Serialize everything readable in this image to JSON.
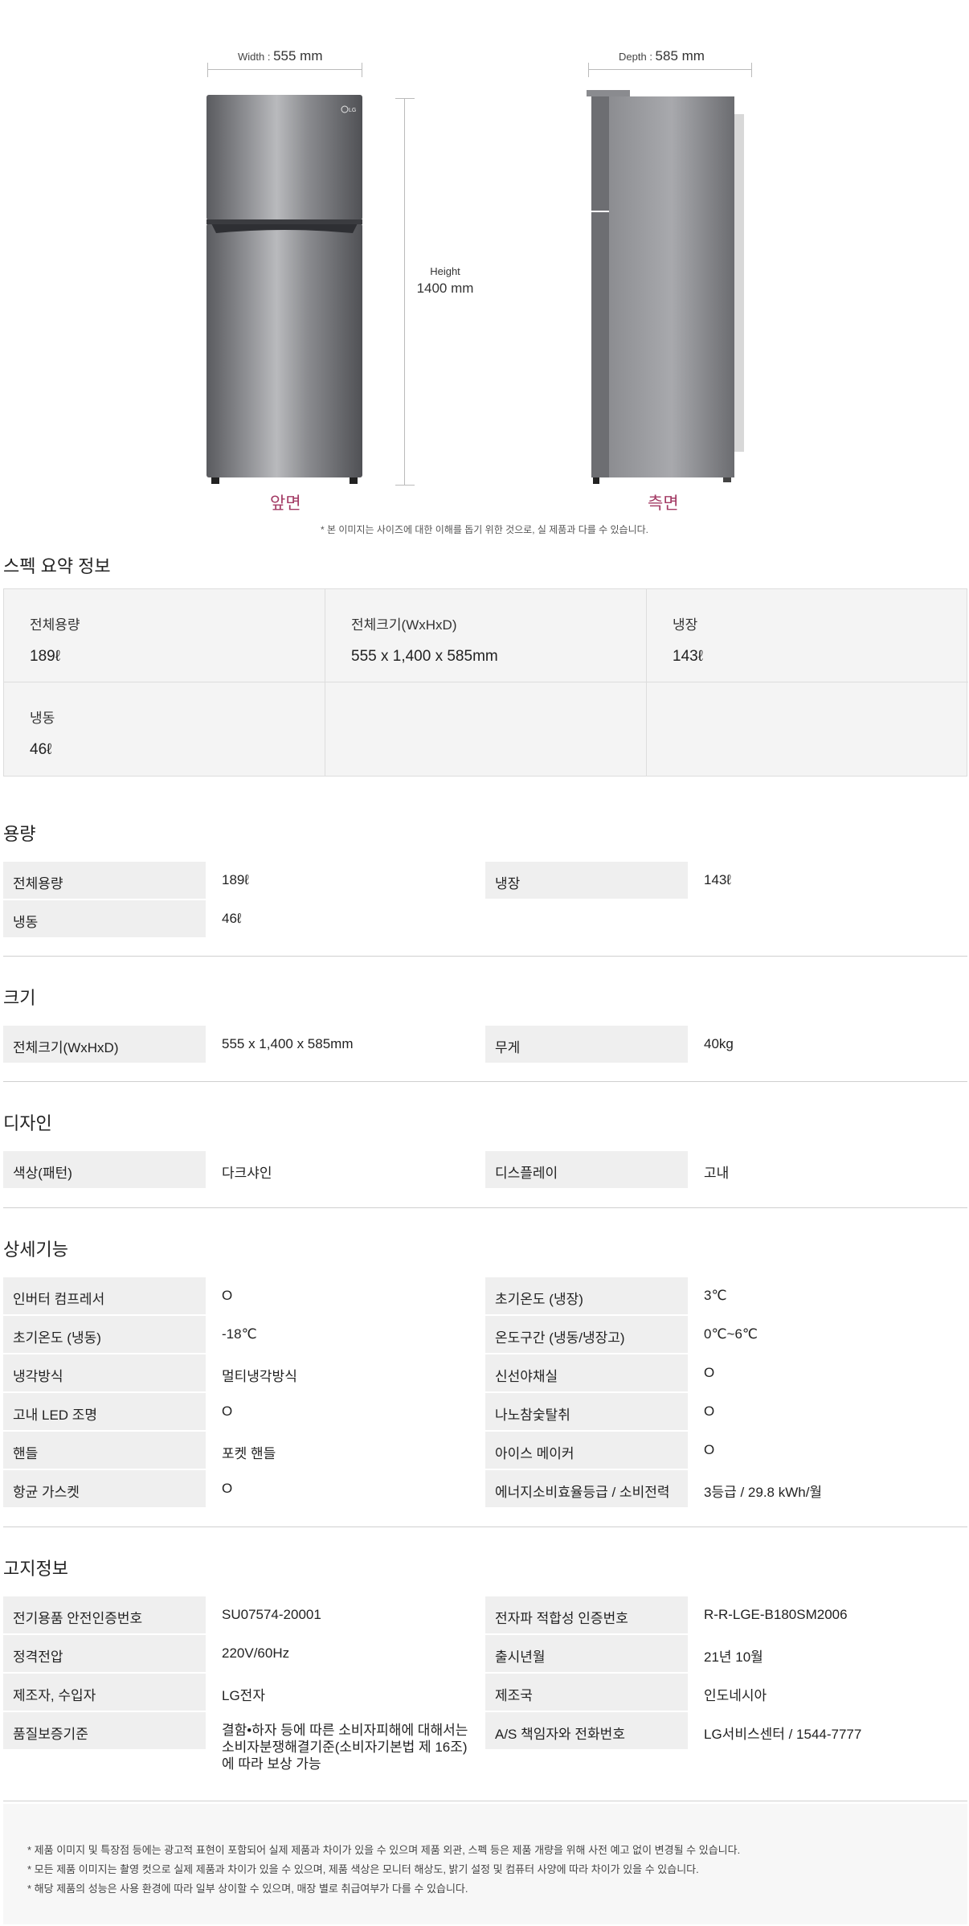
{
  "dimensions": {
    "width_label": "Width",
    "width_value": "555 mm",
    "height_label": "Height",
    "height_value": "1400 mm",
    "depth_label": "Depth",
    "depth_value": "585 mm",
    "front_caption": "앞면",
    "side_caption": "측면",
    "brand_logo": "LG",
    "note": "* 본 이미지는 사이즈에 대한 이해를 돕기 위한 것으로, 실 제품과 다를 수 있습니다."
  },
  "summary": {
    "title": "스펙 요약 정보",
    "items": [
      {
        "label": "전체용량",
        "value": "189ℓ"
      },
      {
        "label": "전체크기(WxHxD)",
        "value": "555 x 1,400 x 585mm"
      },
      {
        "label": "냉장",
        "value": "143ℓ"
      },
      {
        "label": "냉동",
        "value": "46ℓ"
      },
      {
        "label": "",
        "value": ""
      },
      {
        "label": "",
        "value": ""
      }
    ]
  },
  "capacity": {
    "title": "용량",
    "rows": [
      {
        "l_label": "전체용량",
        "l_value": "189ℓ",
        "r_label": "냉장",
        "r_value": "143ℓ"
      },
      {
        "l_label": "냉동",
        "l_value": "46ℓ",
        "r_label": "",
        "r_value": ""
      }
    ]
  },
  "size": {
    "title": "크기",
    "rows": [
      {
        "l_label": "전체크기(WxHxD)",
        "l_value": "555 x 1,400 x 585mm",
        "r_label": "무게",
        "r_value": "40kg"
      }
    ]
  },
  "design": {
    "title": "디자인",
    "rows": [
      {
        "l_label": "색상(패턴)",
        "l_value": "다크샤인",
        "r_label": "디스플레이",
        "r_value": "고내"
      }
    ]
  },
  "features": {
    "title": "상세기능",
    "rows": [
      {
        "l_label": "인버터 컴프레서",
        "l_value": "O",
        "r_label": "초기온도 (냉장)",
        "r_value": "3℃"
      },
      {
        "l_label": "초기온도 (냉동)",
        "l_value": "-18℃",
        "r_label": "온도구간 (냉동/냉장고)",
        "r_value": "0℃~6℃"
      },
      {
        "l_label": "냉각방식",
        "l_value": "멀티냉각방식",
        "r_label": "신선야채실",
        "r_value": "O"
      },
      {
        "l_label": "고내 LED 조명",
        "l_value": "O",
        "r_label": "나노참숯탈취",
        "r_value": "O"
      },
      {
        "l_label": "핸들",
        "l_value": "포켓 핸들",
        "r_label": "아이스 메이커",
        "r_value": "O"
      },
      {
        "l_label": "항균 가스켓",
        "l_value": "O",
        "r_label": "에너지소비효율등급 / 소비전력",
        "r_value": "3등급 / 29.8 kWh/월"
      }
    ]
  },
  "notice": {
    "title": "고지정보",
    "rows": [
      {
        "l_label": "전기용품 안전인증번호",
        "l_value": "SU07574-20001",
        "r_label": "전자파 적합성 인증번호",
        "r_value": "R-R-LGE-B180SM2006"
      },
      {
        "l_label": "정격전압",
        "l_value": "220V/60Hz",
        "r_label": "출시년월",
        "r_value": "21년 10월"
      },
      {
        "l_label": "제조자, 수입자",
        "l_value": "LG전자",
        "r_label": "제조국",
        "r_value": "인도네시아"
      },
      {
        "l_label": "품질보증기준",
        "l_value": "결함•하자 등에 따른 소비자피해에 대해서는 소비자분쟁해결기준(소비자기본법 제 16조)에 따라 보상 가능",
        "r_label": "A/S 책임자와 전화번호",
        "r_value": "LG서비스센터 / 1544-7777"
      }
    ]
  },
  "footer": {
    "notes": [
      "* 제품 이미지 및 특장점 등에는 광고적 표현이 포함되어 실제 제품과 차이가 있을 수 있으며 제품 외관, 스펙 등은 제품 개량을 위해 사전 예고 없이 변경될 수 있습니다.",
      "* 모든 제품 이미지는 촬영 컷으로 실제 제품과 차이가 있을 수 있으며, 제품 색상은 모니터 해상도, 밝기 설정 및 컴퓨터 사양에 따라 차이가 있을 수 있습니다.",
      "* 해당 제품의 성능은 사용 환경에 따라 일부 상이할 수 있으며, 매장 별로 취급여부가 다를 수 있습니다."
    ]
  }
}
